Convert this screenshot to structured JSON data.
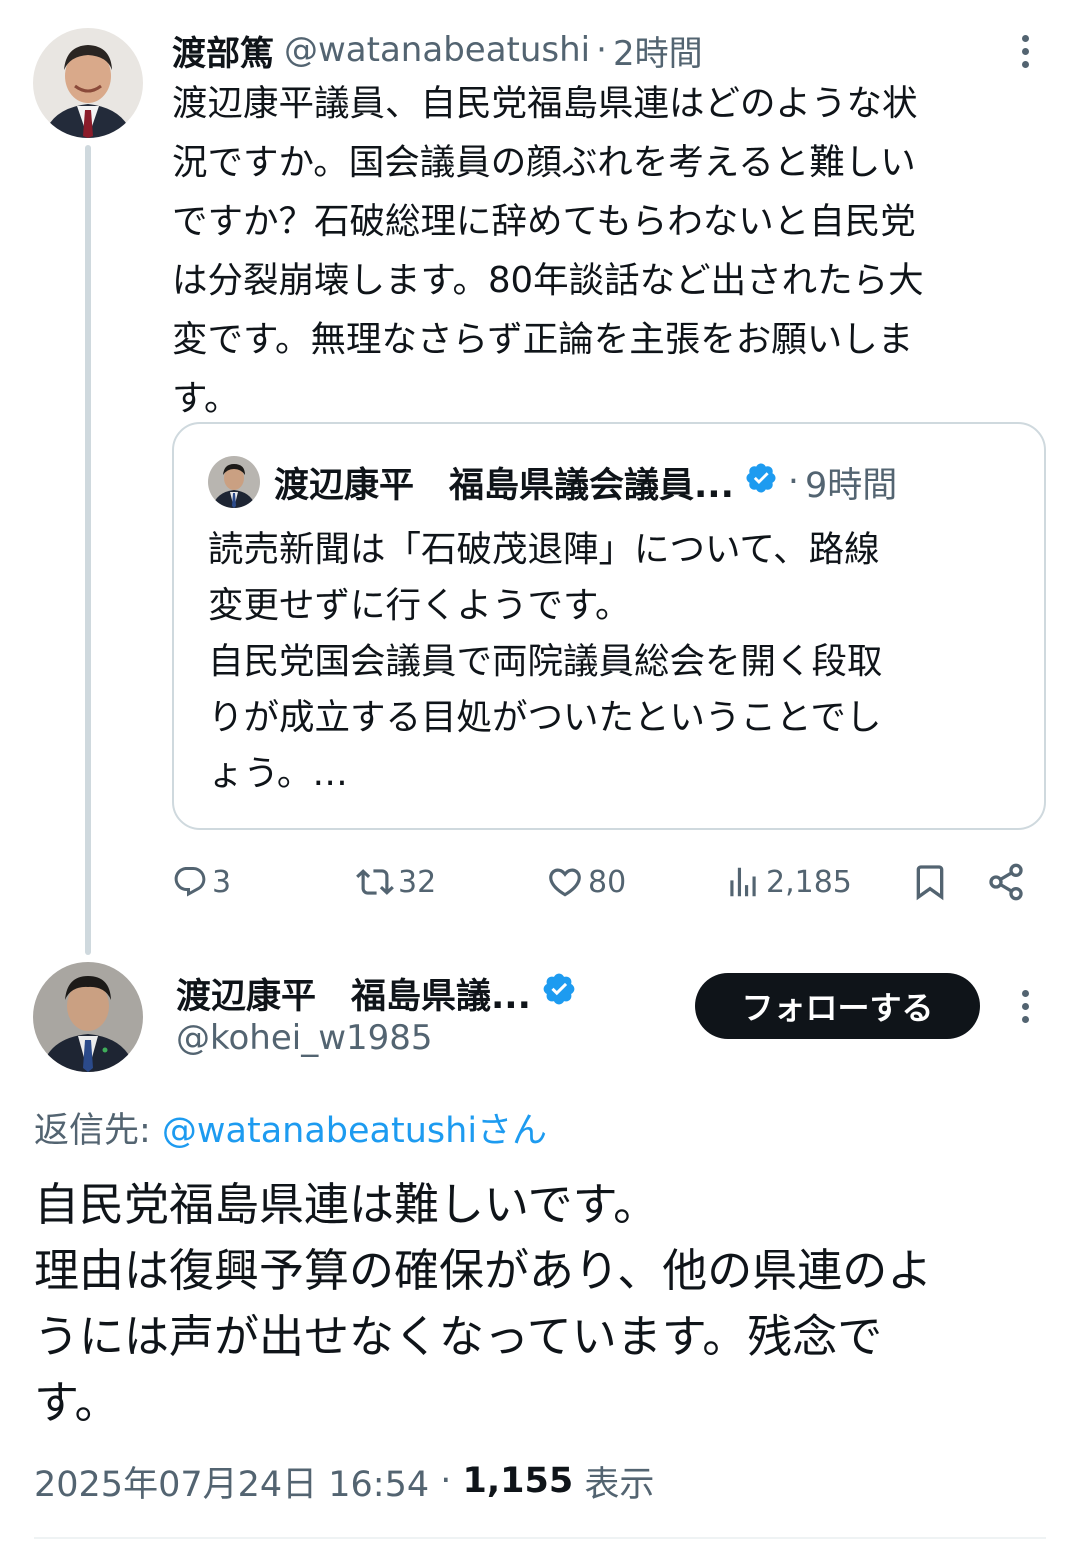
{
  "tweet1": {
    "author_name": "渡部篤",
    "handle": "@watanabeatushi",
    "separator": "·",
    "time": "2時間",
    "text": "渡辺康平議員、自民党福島県連はどのような状\n況ですか。国会議員の顔ぶれを考えると難しい\nですか？石破総理に辞めてもらわないと自民党\nは分裂崩壊します。80年談話など出されたら大\n変です。無理なさらず正論を主張をお願いしま\nす。",
    "quote": {
      "author_name": "渡辺康平　福島県議会議員...",
      "separator": "·",
      "time": "9時間",
      "text": "読売新聞は「石破茂退陣」について、路線\n変更せずに行くようです。\n自民党国会議員で両院議員総会を開く段取\nりが成立する目処がついたということでし\nょう。…"
    },
    "actions": {
      "replies": "3",
      "retweets": "32",
      "likes": "80",
      "views": "2,185"
    }
  },
  "tweet2": {
    "author_name": "渡辺康平　福島県議...",
    "handle": "@kohei_w1985",
    "follow_label": "フォローする",
    "reply_to_label": "返信先: ",
    "reply_to_mention": "@watanabeatushiさん",
    "text": "自民党福島県連は難しいです。\n理由は復興予算の確保があり、他の県連のよ\nうには声が出せなくなっています。残念で\nす。",
    "timestamp": "2025年07月24日 16:54",
    "separator": " · ",
    "view_count": "1,155",
    "view_label": " 表示"
  },
  "colors": {
    "text_primary": "#0f1419",
    "text_secondary": "#536471",
    "link": "#1d9bf0",
    "verified": "#1d9bf0",
    "border": "#cfd9de",
    "follow_bg": "#0f1419"
  },
  "icons": [
    "reply-icon",
    "retweet-icon",
    "like-icon",
    "views-icon",
    "bookmark-icon",
    "share-icon",
    "verified-badge-icon",
    "more-icon"
  ]
}
